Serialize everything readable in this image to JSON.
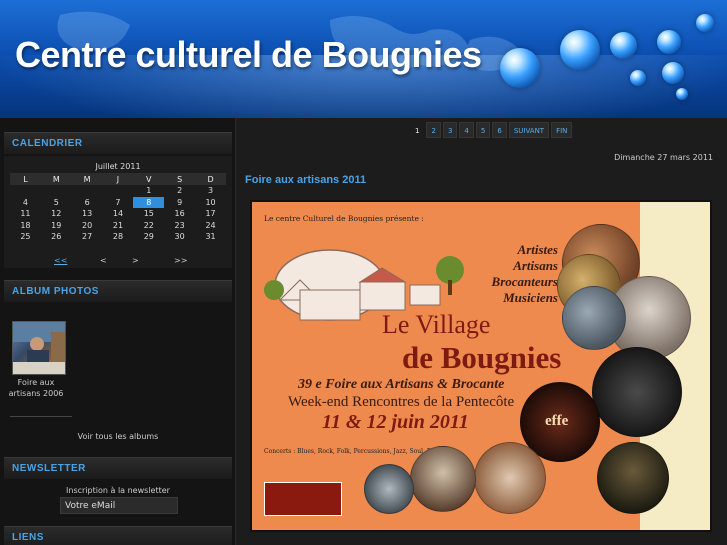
{
  "site": {
    "title": "Centre culturel de Bougnies"
  },
  "sidebar": {
    "calendar": {
      "title": "CALENDRIER",
      "month": "Juillet 2011",
      "days": [
        "L",
        "M",
        "M",
        "J",
        "V",
        "S",
        "D"
      ],
      "weeks": [
        [
          "",
          "",
          "",
          "",
          "1",
          "2",
          "3"
        ],
        [
          "4",
          "5",
          "6",
          "7",
          "8",
          "9",
          "10"
        ],
        [
          "11",
          "12",
          "13",
          "14",
          "15",
          "16",
          "17"
        ],
        [
          "18",
          "19",
          "20",
          "21",
          "22",
          "23",
          "24"
        ],
        [
          "25",
          "26",
          "27",
          "28",
          "29",
          "30",
          "31"
        ]
      ],
      "today": "8",
      "nav": {
        "prev_year": "<<",
        "prev": "<",
        "next": ">",
        "next_year": ">>"
      }
    },
    "albums": {
      "title": "ALBUM PHOTOS",
      "album_caption": "Foire aux artisans 2006",
      "view_all": "Voir tous les albums"
    },
    "newsletter": {
      "title": "NEWSLETTER",
      "label": "Inscription à la newsletter",
      "input_value": "Votre eMail"
    },
    "links": {
      "title": "LIENS"
    }
  },
  "main": {
    "pager": [
      "1",
      "2",
      "3",
      "4",
      "5",
      "6",
      "SUIVANT",
      "FIN"
    ],
    "current_page": "1",
    "date": "Dimanche 27 mars 2011",
    "article_title": "Foire aux artisans 2011",
    "poster": {
      "intro": "Le centre Culturel de Bougnies présente :",
      "categories": [
        "Artistes",
        "Artisans",
        "Brocanteurs",
        "Musiciens"
      ],
      "title_line1": "Le Village",
      "title_line2": "de Bougnies",
      "edition": "39 e Foire aux Artisans & Brocante",
      "weekend": "Week-end Rencontres de la Pentecôte",
      "dates": "11 & 12 juin 2011",
      "concerts": "Concerts : Blues, Rock, Folk, Percussions, Jazz, Soul, Disco...",
      "photo_text": "effe"
    }
  },
  "colors": {
    "accent": "#4aa3e6",
    "header_blue": "#0c4fb1",
    "today": "#2f8fdd",
    "poster_orange": "#ee8a4e"
  }
}
